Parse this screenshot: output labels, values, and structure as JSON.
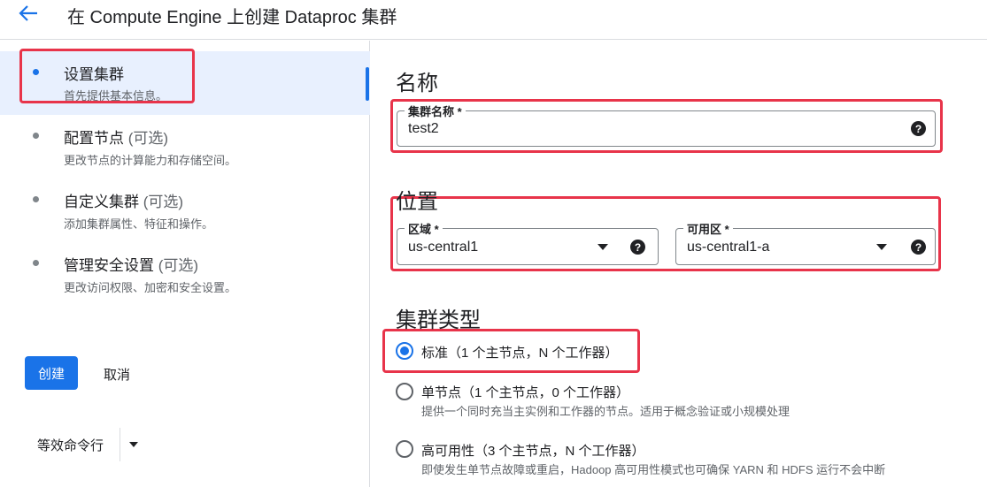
{
  "header": {
    "title": "在 Compute Engine 上创建 Dataproc 集群"
  },
  "steps": [
    {
      "title": "设置集群",
      "optional": "",
      "subtitle": "首先提供基本信息。"
    },
    {
      "title": "配置节点",
      "optional": " (可选)",
      "subtitle": "更改节点的计算能力和存储空间。"
    },
    {
      "title": "自定义集群",
      "optional": " (可选)",
      "subtitle": "添加集群属性、特征和操作。"
    },
    {
      "title": "管理安全设置",
      "optional": " (可选)",
      "subtitle": "更改访问权限、加密和安全设置。"
    }
  ],
  "actions": {
    "create": "创建",
    "cancel": "取消",
    "command_line": "等效命令行"
  },
  "name_section": {
    "heading": "名称",
    "cluster_name_label": "集群名称 *",
    "cluster_name_value": "test2"
  },
  "location_section": {
    "heading": "位置",
    "region_label": "区域 *",
    "region_value": "us-central1",
    "zone_label": "可用区 *",
    "zone_value": "us-central1-a"
  },
  "cluster_type_section": {
    "heading": "集群类型",
    "options": [
      {
        "label": "标准（1 个主节点，N 个工作器）",
        "description": "",
        "selected": true
      },
      {
        "label": "单节点（1 个主节点，0 个工作器）",
        "description": "提供一个同时充当主实例和工作器的节点。适用于概念验证或小规模处理",
        "selected": false
      },
      {
        "label": "高可用性（3 个主节点，N 个工作器）",
        "description": "即使发生单节点故障或重启，Hadoop 高可用性模式也可确保 YARN 和 HDFS 运行不会中断",
        "selected": false
      }
    ]
  },
  "colors": {
    "accent": "#1a73e8",
    "highlight": "#e8344a"
  },
  "icons": {
    "back": "arrow-back-icon",
    "help": "help-icon",
    "dropdown": "dropdown-caret-icon"
  }
}
